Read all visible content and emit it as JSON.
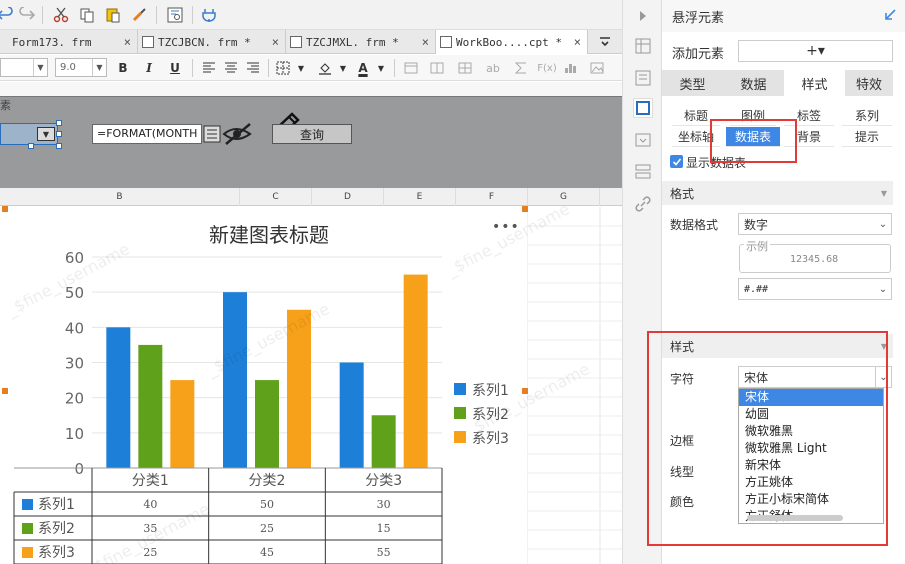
{
  "toolbar1": {
    "icons": [
      "undo-icon",
      "redo-icon",
      "cut-icon",
      "copy-icon",
      "paste-icon",
      "format-painter-icon",
      "preview-icon",
      "plugin-icon"
    ]
  },
  "tabs": [
    {
      "label": "Form173. frm",
      "close": "×"
    },
    {
      "label": "TZCJBCN. frm *",
      "close": "×"
    },
    {
      "label": "TZCJMXL. frm *",
      "close": "×"
    },
    {
      "label": "WorkBoo....cpt *",
      "close": "×"
    }
  ],
  "toolbar2": {
    "font_size": "9.0",
    "bold": "B",
    "italic": "I",
    "underline": "U",
    "font_color_letter": "A",
    "ab_label": "ab",
    "fx_label": "F(x)"
  },
  "param_area": {
    "label": "素",
    "formula": "=FORMAT(MONTH",
    "query_button": "查询"
  },
  "columns": [
    "B",
    "C",
    "D",
    "E",
    "F",
    "G"
  ],
  "chart_menu": "•••",
  "chart_data": {
    "type": "bar",
    "title": "新建图表标题",
    "categories": [
      "分类1",
      "分类2",
      "分类3"
    ],
    "series": [
      {
        "name": "系列1",
        "values": [
          40,
          50,
          30
        ],
        "color": "#1d7fd8"
      },
      {
        "name": "系列2",
        "values": [
          35,
          25,
          15
        ],
        "color": "#5fa11a"
      },
      {
        "name": "系列3",
        "values": [
          25,
          45,
          55
        ],
        "color": "#f7a11a"
      }
    ],
    "ylim": [
      0,
      60
    ],
    "yticks": [
      0,
      10,
      20,
      30,
      40,
      50,
      60
    ],
    "legend_position": "right",
    "data_table": true
  },
  "watermark_text": "_$fine_username",
  "panel": {
    "title": "悬浮元素",
    "add_element_label": "添加元素",
    "add_button": "+▾",
    "main_tabs": [
      "类型",
      "数据",
      "样式",
      "特效"
    ],
    "active_main_tab": "样式",
    "sub_tabs": [
      "标题",
      "图例",
      "标签",
      "系列",
      "坐标轴",
      "数据表",
      "背景",
      "提示"
    ],
    "active_sub_tab": "数据表",
    "show_table_label": "显示数据表",
    "format_section": "格式",
    "data_format_label": "数据格式",
    "data_format_value": "数字",
    "example_label": "示例",
    "example_value": "12345.68",
    "pattern_value": "#.##",
    "style_section": "样式",
    "font_label": "字符",
    "font_value": "宋体",
    "font_options": [
      "宋体",
      "幼圆",
      "微软雅黑",
      "微软雅黑 Light",
      "新宋体",
      "方正姚体",
      "方正小标宋简体",
      "方正舒体"
    ],
    "border_label": "边框",
    "line_label": "线型",
    "color_label": "颜色"
  }
}
